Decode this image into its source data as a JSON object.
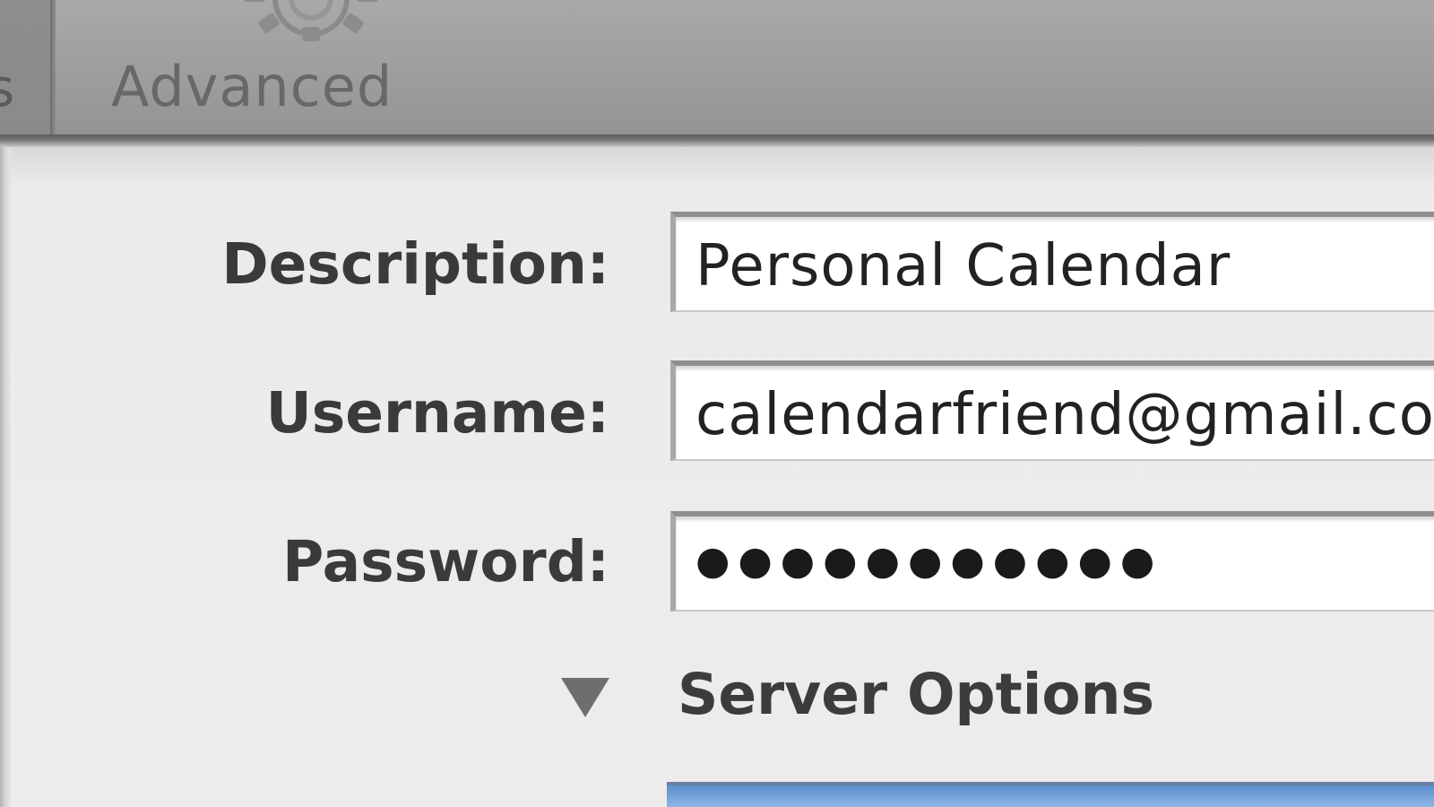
{
  "toolbar": {
    "previous_label_fragment": "s",
    "advanced_label": "Advanced",
    "advanced_icon": "gear-icon"
  },
  "form": {
    "description_label": "Description:",
    "description_value": "Personal Calendar",
    "username_label": "Username:",
    "username_value": "calendarfriend@gmail.co",
    "password_label": "Password:",
    "password_value": "●●●●●●●●●●●",
    "server_options_label": "Server Options",
    "server_options_icon": "disclosure-triangle-down-icon"
  },
  "colors": {
    "toolbar_bg": "#9f9f9f",
    "panel_bg": "#ececec",
    "selection_blue": "#6f9fdb"
  }
}
